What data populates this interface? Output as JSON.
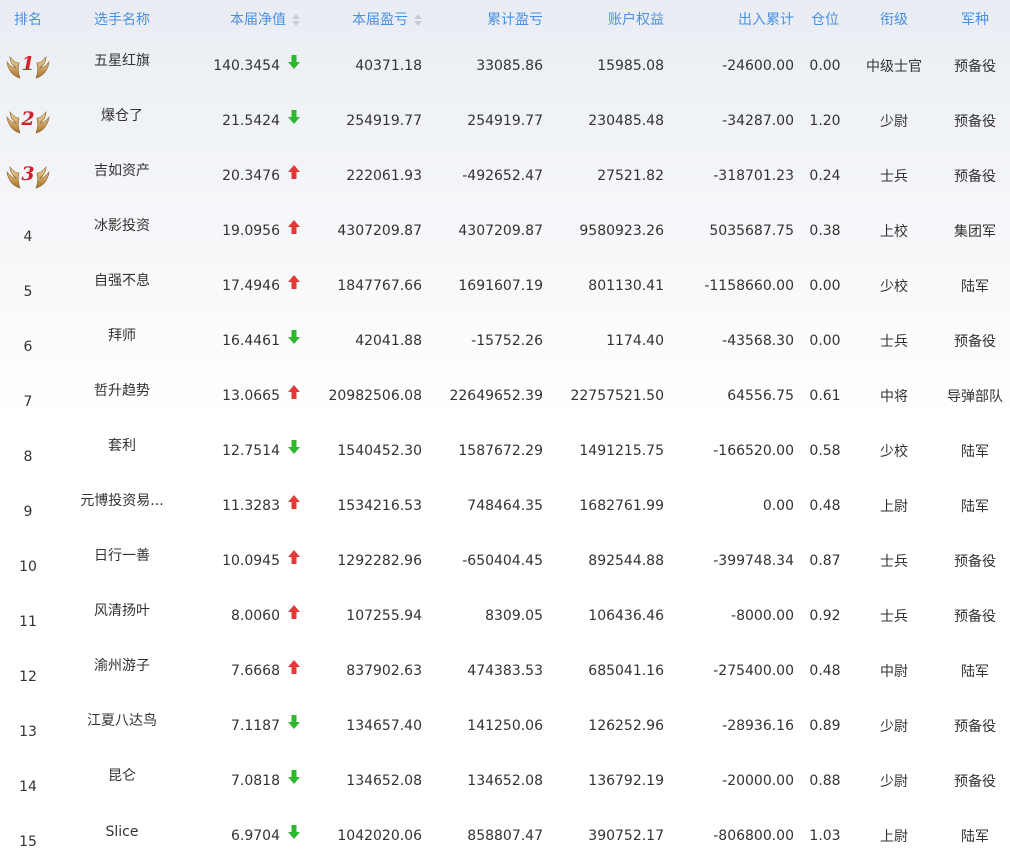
{
  "headers": {
    "rank": "排名",
    "name": "选手名称",
    "nav": "本届净值",
    "pnl": "本届盈亏",
    "cum_pnl": "累计盈亏",
    "equity": "账户权益",
    "inout": "出入累计",
    "position": "仓位",
    "title": "衔级",
    "branch": "军种"
  },
  "colors": {
    "header_text": "#4a90e2",
    "up_arrow": "#e53935",
    "down_arrow": "#2eb82e",
    "medal_number": "#d6202a"
  },
  "rows": [
    {
      "rank": "1",
      "name": "五星红旗",
      "nav": "140.3454",
      "trend": "down",
      "pnl": "40371.18",
      "cum_pnl": "33085.86",
      "equity": "15985.08",
      "inout": "-24600.00",
      "position": "0.00",
      "title": "中级士官",
      "branch": "预备役"
    },
    {
      "rank": "2",
      "name": "爆仓了",
      "nav": "21.5424",
      "trend": "down",
      "pnl": "254919.77",
      "cum_pnl": "254919.77",
      "equity": "230485.48",
      "inout": "-34287.00",
      "position": "1.20",
      "title": "少尉",
      "branch": "预备役"
    },
    {
      "rank": "3",
      "name": "吉如资产",
      "nav": "20.3476",
      "trend": "up",
      "pnl": "222061.93",
      "cum_pnl": "-492652.47",
      "equity": "27521.82",
      "inout": "-318701.23",
      "position": "0.24",
      "title": "士兵",
      "branch": "预备役"
    },
    {
      "rank": "4",
      "name": "冰影投资",
      "nav": "19.0956",
      "trend": "up",
      "pnl": "4307209.87",
      "cum_pnl": "4307209.87",
      "equity": "9580923.26",
      "inout": "5035687.75",
      "position": "0.38",
      "title": "上校",
      "branch": "集团军"
    },
    {
      "rank": "5",
      "name": "自强不息",
      "nav": "17.4946",
      "trend": "up",
      "pnl": "1847767.66",
      "cum_pnl": "1691607.19",
      "equity": "801130.41",
      "inout": "-1158660.00",
      "position": "0.00",
      "title": "少校",
      "branch": "陆军"
    },
    {
      "rank": "6",
      "name": "拜师",
      "nav": "16.4461",
      "trend": "down",
      "pnl": "42041.88",
      "cum_pnl": "-15752.26",
      "equity": "1174.40",
      "inout": "-43568.30",
      "position": "0.00",
      "title": "士兵",
      "branch": "预备役"
    },
    {
      "rank": "7",
      "name": "哲升趋势",
      "nav": "13.0665",
      "trend": "up",
      "pnl": "20982506.08",
      "cum_pnl": "22649652.39",
      "equity": "22757521.50",
      "inout": "64556.75",
      "position": "0.61",
      "title": "中将",
      "branch": "导弹部队"
    },
    {
      "rank": "8",
      "name": "套利",
      "nav": "12.7514",
      "trend": "down",
      "pnl": "1540452.30",
      "cum_pnl": "1587672.29",
      "equity": "1491215.75",
      "inout": "-166520.00",
      "position": "0.58",
      "title": "少校",
      "branch": "陆军"
    },
    {
      "rank": "9",
      "name": "元博投资易...",
      "nav": "11.3283",
      "trend": "up",
      "pnl": "1534216.53",
      "cum_pnl": "748464.35",
      "equity": "1682761.99",
      "inout": "0.00",
      "position": "0.48",
      "title": "上尉",
      "branch": "陆军"
    },
    {
      "rank": "10",
      "name": "日行一善",
      "nav": "10.0945",
      "trend": "up",
      "pnl": "1292282.96",
      "cum_pnl": "-650404.45",
      "equity": "892544.88",
      "inout": "-399748.34",
      "position": "0.87",
      "title": "士兵",
      "branch": "预备役"
    },
    {
      "rank": "11",
      "name": "风清扬叶",
      "nav": "8.0060",
      "trend": "up",
      "pnl": "107255.94",
      "cum_pnl": "8309.05",
      "equity": "106436.46",
      "inout": "-8000.00",
      "position": "0.92",
      "title": "士兵",
      "branch": "预备役"
    },
    {
      "rank": "12",
      "name": "渝州游子",
      "nav": "7.6668",
      "trend": "up",
      "pnl": "837902.63",
      "cum_pnl": "474383.53",
      "equity": "685041.16",
      "inout": "-275400.00",
      "position": "0.48",
      "title": "中尉",
      "branch": "陆军"
    },
    {
      "rank": "13",
      "name": "江夏八达鸟",
      "nav": "7.1187",
      "trend": "down",
      "pnl": "134657.40",
      "cum_pnl": "141250.06",
      "equity": "126252.96",
      "inout": "-28936.16",
      "position": "0.89",
      "title": "少尉",
      "branch": "预备役"
    },
    {
      "rank": "14",
      "name": "昆仑",
      "nav": "7.0818",
      "trend": "down",
      "pnl": "134652.08",
      "cum_pnl": "134652.08",
      "equity": "136792.19",
      "inout": "-20000.00",
      "position": "0.88",
      "title": "少尉",
      "branch": "预备役"
    },
    {
      "rank": "15",
      "name": "Slice",
      "nav": "6.9704",
      "trend": "down",
      "pnl": "1042020.06",
      "cum_pnl": "858807.47",
      "equity": "390752.17",
      "inout": "-806800.00",
      "position": "1.03",
      "title": "上尉",
      "branch": "陆军"
    }
  ]
}
